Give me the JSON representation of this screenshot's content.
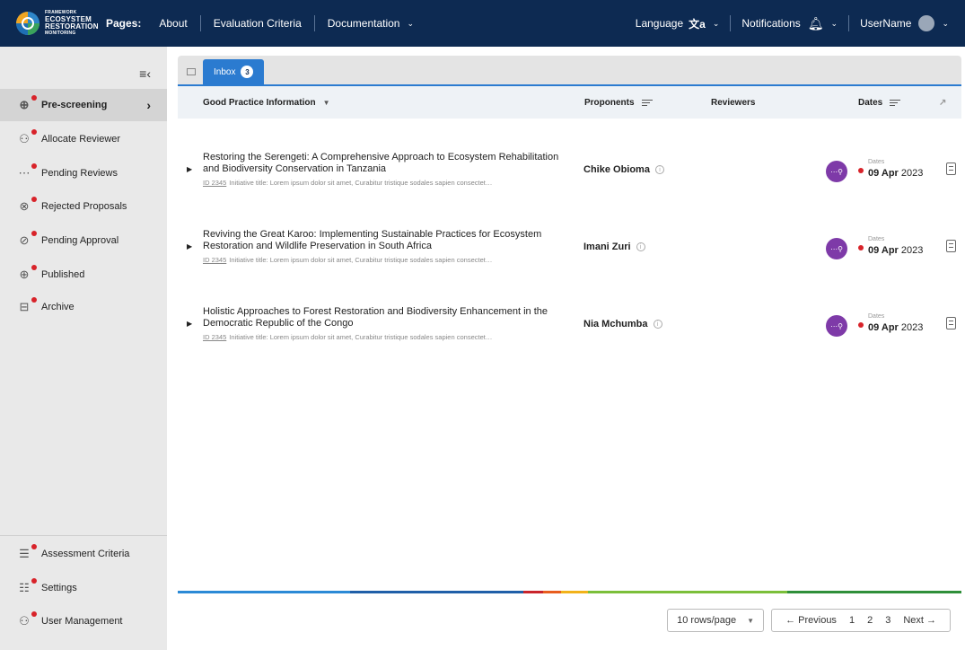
{
  "brand": {
    "line1": "FRAMEWORK",
    "line2": "ECOSYSTEM",
    "line3": "RESTORATION",
    "line4": "MONITORING"
  },
  "nav": {
    "pages_label": "Pages:",
    "links": [
      "About",
      "Evaluation Criteria",
      "Documentation"
    ],
    "language": "Language",
    "language_icon": "文a",
    "notifications": "Notifications",
    "username": "UserName"
  },
  "sidebar": {
    "items": [
      {
        "label": "Pre-screening",
        "icon": "download-circle-icon",
        "glyph": "⊕"
      },
      {
        "label": "Allocate Reviewer",
        "icon": "add-user-icon",
        "glyph": "⚇"
      },
      {
        "label": "Pending Reviews",
        "icon": "more-circle-icon",
        "glyph": "⋯"
      },
      {
        "label": "Rejected Proposals",
        "icon": "x-circle-icon",
        "glyph": "⊗"
      },
      {
        "label": "Pending Approval",
        "icon": "check-circle-icon",
        "glyph": "⊘"
      },
      {
        "label": "Published",
        "icon": "globe-icon",
        "glyph": "⊕"
      },
      {
        "label": "Archive",
        "icon": "archive-icon",
        "glyph": "⊟"
      }
    ],
    "bottom": [
      {
        "label": "Assessment Criteria",
        "icon": "checklist-icon",
        "glyph": "☰"
      },
      {
        "label": "Settings",
        "icon": "sliders-icon",
        "glyph": "☷"
      },
      {
        "label": "User Management",
        "icon": "users-icon",
        "glyph": "⚇"
      }
    ]
  },
  "tabs": [
    {
      "label": "Inbox",
      "count": "3"
    }
  ],
  "table": {
    "headers": {
      "info": "Good Practice Information",
      "proponents": "Proponents",
      "reviewers": "Reviewers",
      "dates": "Dates"
    },
    "rows": [
      {
        "title": "Restoring the Serengeti: A Comprehensive Approach to Ecosystem Rehabilitation and Biodiversity Conservation in Tanzania",
        "id": "ID 2345",
        "meta": "Initiative title: Lorem ipsum dolor sit amet, Curabitur tristique sodales sapien consectet…",
        "proponent": "Chike Obioma",
        "date_label": "Dates",
        "date_day": "09 Apr",
        "date_year": "2023"
      },
      {
        "title": "Reviving the Great Karoo: Implementing Sustainable Practices for Ecosystem Restoration and Wildlife Preservation in South Africa",
        "id": "ID 2345",
        "meta": "Initiative title: Lorem ipsum dolor sit amet, Curabitur tristique sodales sapien consectet…",
        "proponent": "Imani Zuri",
        "date_label": "Dates",
        "date_day": "09 Apr",
        "date_year": "2023"
      },
      {
        "title": "Holistic Approaches to Forest Restoration and Biodiversity Enhancement in the Democratic Republic of the Congo",
        "id": "ID 2345",
        "meta": "Initiative title: Lorem ipsum dolor sit amet, Curabitur tristique sodales sapien consectet…",
        "proponent": "Nia Mchumba",
        "date_label": "Dates",
        "date_day": "09 Apr",
        "date_year": "2023"
      }
    ]
  },
  "pagination": {
    "rows_per_page": "10 rows/page",
    "previous": "← Previous",
    "pages": [
      "1",
      "2",
      "3"
    ],
    "next": "Next →"
  },
  "colors": {
    "navy": "#0d2a52",
    "accent_blue": "#2b7bd0",
    "purple": "#7e3aa8",
    "red_dot": "#d8232a"
  }
}
